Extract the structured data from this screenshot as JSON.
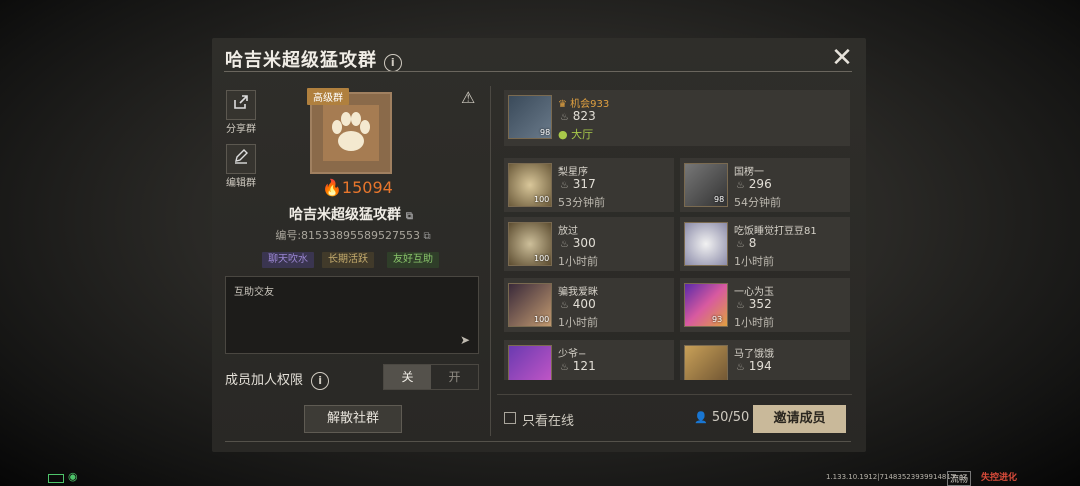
{
  "header": {
    "title": "哈吉米超级猛攻群",
    "info_icon": "ⓘ",
    "close": "✕"
  },
  "side": {
    "share_label": "分享群",
    "edit_label": "编辑群"
  },
  "group": {
    "level_badge": "高级群",
    "score": "15094",
    "name": "哈吉米超级猛攻群",
    "id_text": "编号:81533895589527553",
    "tags": [
      {
        "label": "聊天吹水",
        "color": "#8c74c8"
      },
      {
        "label": "长期活跃",
        "color": "#b9a063"
      },
      {
        "label": "友好互助",
        "color": "#7ab85c"
      }
    ],
    "description": "互助交友"
  },
  "permission": {
    "label": "成员加人权限",
    "off": "关",
    "on": "开"
  },
  "dissolve_label": "解散社群",
  "leader": {
    "name": "机会933",
    "score": "823",
    "status": "大厅",
    "level": "98"
  },
  "members": [
    {
      "name": "梨星序",
      "score": "317",
      "time": "53分钟前",
      "level": "100"
    },
    {
      "name": "国楞一",
      "score": "296",
      "time": "54分钟前",
      "level": "98"
    },
    {
      "name": "放过",
      "score": "300",
      "time": "1小时前",
      "level": "100"
    },
    {
      "name": "吃饭睡觉打豆豆81",
      "score": "8",
      "time": "1小时前",
      "level": ""
    },
    {
      "name": "骗我爱眯",
      "score": "400",
      "time": "1小时前",
      "level": "100"
    },
    {
      "name": "一心为玉",
      "score": "352",
      "time": "1小时前",
      "level": "93"
    },
    {
      "name": "少爷−",
      "score": "121",
      "time": "",
      "level": ""
    },
    {
      "name": "马了饿饿",
      "score": "194",
      "time": "",
      "level": ""
    }
  ],
  "footer": {
    "online_only": "只看在线",
    "member_count": "50/50",
    "invite": "邀请成员",
    "version": "1.133.10.1912|71483523939914817",
    "mode": "流畅",
    "logo": "失控进化"
  },
  "colors": {
    "accent_orange": "#e8762c",
    "leader_name": "#e0a040",
    "online": "#a8c84a"
  },
  "icons": [
    "share-icon",
    "edit-icon",
    "warning-icon",
    "close-icon",
    "info-icon",
    "flame-icon",
    "crown-icon",
    "send-icon",
    "person-icon"
  ]
}
